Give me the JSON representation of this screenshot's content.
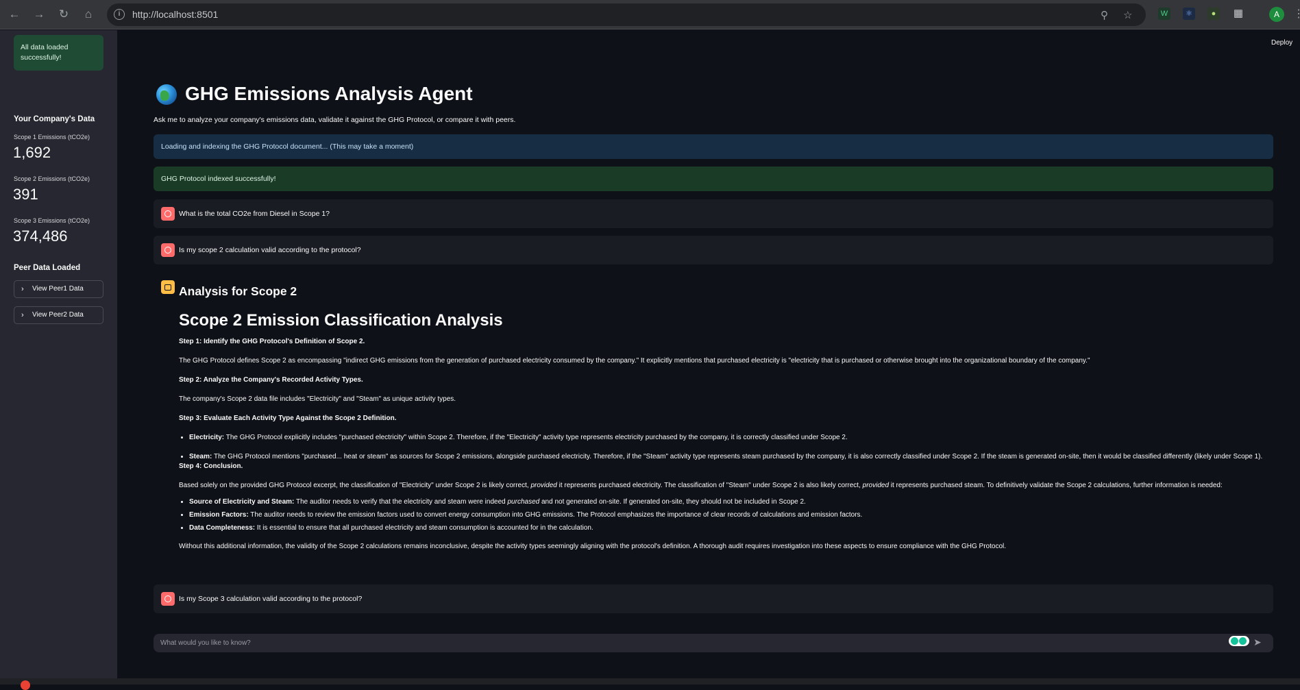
{
  "browser": {
    "url": "http://localhost:8501",
    "profile_initial": "A"
  },
  "header": {
    "deploy_label": "Deploy"
  },
  "sidebar": {
    "status_message": "All data loaded successfully!",
    "company_heading": "Your Company's Data",
    "metrics": [
      {
        "label": "Scope 1 Emissions (tCO2e)",
        "value": "1,692"
      },
      {
        "label": "Scope 2 Emissions (tCO2e)",
        "value": "391"
      },
      {
        "label": "Scope 3 Emissions (tCO2e)",
        "value": "374,486"
      }
    ],
    "peer_heading": "Peer Data Loaded",
    "peer_expanders": [
      "View Peer1 Data",
      "View Peer2 Data"
    ]
  },
  "main": {
    "title": "GHG Emissions Analysis Agent",
    "subtitle": "Ask me to analyze your company's emissions data, validate it against the GHG Protocol, or compare it with peers.",
    "info_alert": "Loading and indexing the GHG Protocol document... (This may take a moment)",
    "success_alert": "GHG Protocol indexed successfully!",
    "user_messages": [
      "What is the total CO2e from Diesel in Scope 1?",
      "Is my scope 2 calculation valid according to the protocol?",
      "Is my Scope 3 calculation valid according to the protocol?"
    ],
    "assistant": {
      "heading": "Analysis for Scope 2",
      "section_title": "Scope 2 Emission Classification Analysis",
      "step1_title": "Step 1: Identify the GHG Protocol's Definition of Scope 2.",
      "step1_text": "The GHG Protocol defines Scope 2 as encompassing \"indirect GHG emissions from the generation of purchased electricity consumed by the company.\" It explicitly mentions that purchased electricity is \"electricity that is purchased or otherwise brought into the organizational boundary of the company.\"",
      "step2_title": "Step 2: Analyze the Company's Recorded Activity Types.",
      "step2_text": "The company's Scope 2 data file includes \"Electricity\" and \"Steam\" as unique activity types.",
      "step3_title": "Step 3: Evaluate Each Activity Type Against the Scope 2 Definition.",
      "step3_items": [
        {
          "term": "Electricity:",
          "text": " The GHG Protocol explicitly includes \"purchased electricity\" within Scope 2. Therefore, if the \"Electricity\" activity type represents electricity purchased by the company, it is correctly classified under Scope 2."
        },
        {
          "term": "Steam:",
          "text": " The GHG Protocol mentions \"purchased... heat or steam\" as sources for Scope 2 emissions, alongside purchased electricity. Therefore, if the \"Steam\" activity type represents steam purchased by the company, it is also correctly classified under Scope 2. If the steam is generated on-site, then it would be classified differently (likely under Scope 1)."
        }
      ],
      "step4_title": "Step 4: Conclusion.",
      "conclusion_part1": "Based solely on the provided GHG Protocol excerpt, the classification of \"Electricity\" under Scope 2 is likely correct, ",
      "conclusion_em1": "provided",
      "conclusion_part2": " it represents purchased electricity. The classification of \"Steam\" under Scope 2 is also likely correct, ",
      "conclusion_em2": "provided",
      "conclusion_part3": " it represents purchased steam. To definitively validate the Scope 2 calculations, further information is needed:",
      "needs_source_term": "Source of Electricity and Steam:",
      "needs_source_text1": " The auditor needs to verify that the electricity and steam were indeed ",
      "needs_source_em": "purchased",
      "needs_source_text2": " and not generated on-site. If generated on-site, they should not be included in Scope 2.",
      "needs_factors_term": "Emission Factors:",
      "needs_factors_text": " The auditor needs to review the emission factors used to convert energy consumption into GHG emissions. The Protocol emphasizes the importance of clear records of calculations and emission factors.",
      "needs_data_term": "Data Completeness:",
      "needs_data_text": " It is essential to ensure that all purchased electricity and steam consumption is accounted for in the calculation.",
      "final_text": "Without this additional information, the validity of the Scope 2 calculations remains inconclusive, despite the activity types seemingly aligning with the protocol's definition. A thorough audit requires investigation into these aspects to ensure compliance with the GHG Protocol."
    },
    "chat_placeholder": "What would you like to know?"
  }
}
